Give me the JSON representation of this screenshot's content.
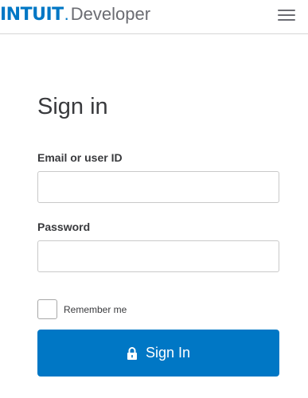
{
  "header": {
    "logo_brand": "INTUIT",
    "logo_dot": ".",
    "logo_product": "Developer",
    "menu_icon": "hamburger-menu-icon"
  },
  "form": {
    "title": "Sign in",
    "email_label": "Email or user ID",
    "email_value": "",
    "email_placeholder": "",
    "password_label": "Password",
    "password_value": "",
    "password_placeholder": "",
    "remember_label": "Remember me",
    "remember_checked": false,
    "submit_label": "Sign In",
    "submit_icon": "lock-icon"
  },
  "colors": {
    "brand_blue": "#0077c5",
    "text_dark": "#393a3d",
    "text_gray": "#6b6c72"
  }
}
